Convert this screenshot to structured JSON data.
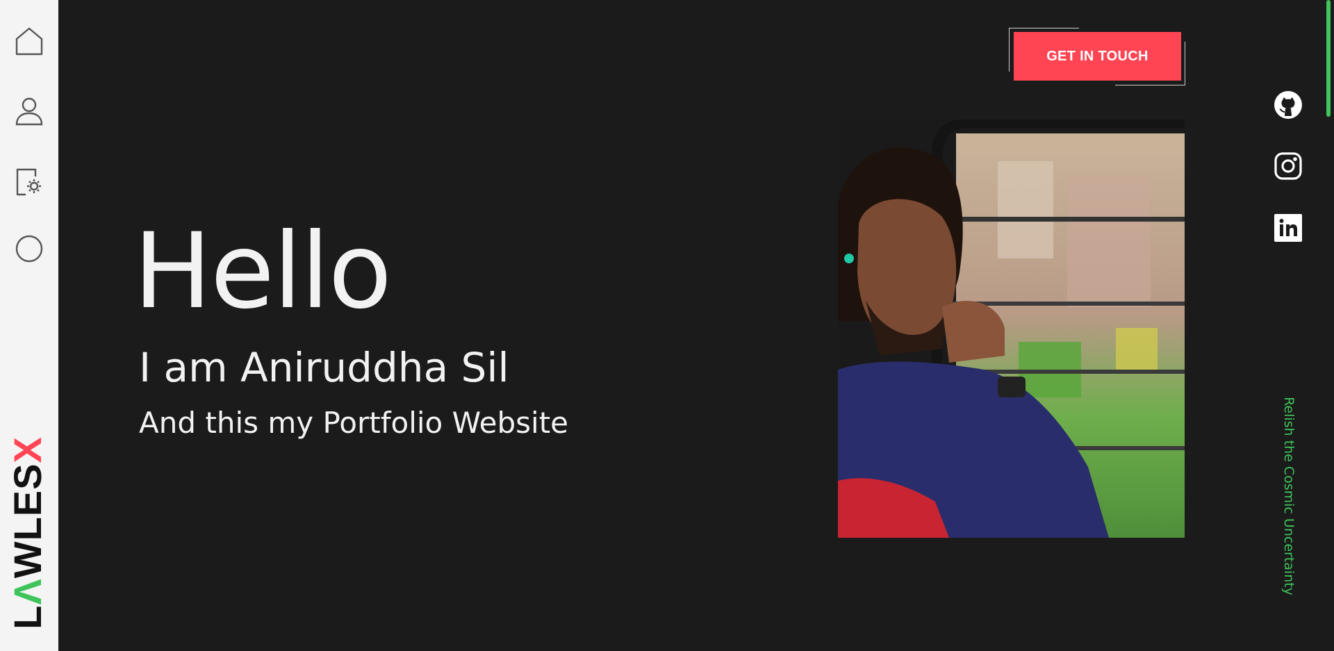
{
  "sidebar": {
    "nav": [
      {
        "icon": "home-icon"
      },
      {
        "icon": "user-icon"
      },
      {
        "icon": "settings-document-icon"
      },
      {
        "icon": "circle-icon"
      }
    ],
    "logo": {
      "text_dark_1": "L",
      "text_green": "Λ",
      "text_dark_2": "WLES",
      "text_red": "X"
    }
  },
  "header": {
    "cta_label": "GET IN TOUCH"
  },
  "hero": {
    "greeting": "Hello",
    "name_line": "I am Aniruddha Sil",
    "sub_line": "And this my Portfolio Website"
  },
  "social": [
    {
      "icon": "github-icon"
    },
    {
      "icon": "instagram-icon"
    },
    {
      "icon": "linkedin-icon"
    }
  ],
  "tagline": "Relish the Cosmic Uncertainty",
  "colors": {
    "background": "#1b1b1b",
    "sidebar": "#f4f4f4",
    "accent_red": "#ff4553",
    "accent_green": "#3ec45a",
    "text": "#f2f2f2"
  }
}
